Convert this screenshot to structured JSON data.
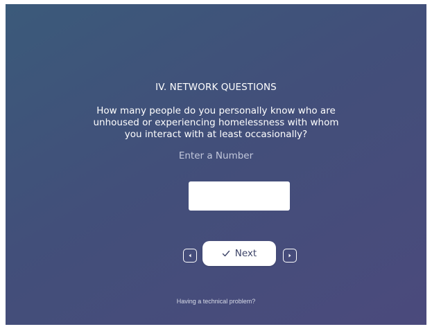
{
  "survey": {
    "section_title": "IV. NETWORK QUESTIONS",
    "question": "How many people do you personally know who are unhoused or experiencing homelessness with whom you interact with at least occasionally?",
    "hint": "Enter a Number",
    "answer_value": "",
    "answer_placeholder": ""
  },
  "navigation": {
    "prev_icon": "caret-left-icon",
    "next_icon": "caret-right-icon",
    "next_label": "Next",
    "next_button_icon": "check-icon"
  },
  "footer": {
    "tech_problem_link": "Having a technical problem?"
  },
  "colors": {
    "background_start": "#3b5a7a",
    "background_end": "#4b4a7c",
    "button_bg": "#ffffff",
    "button_text": "#3d4468",
    "hint_text": "#c3c8dc"
  }
}
